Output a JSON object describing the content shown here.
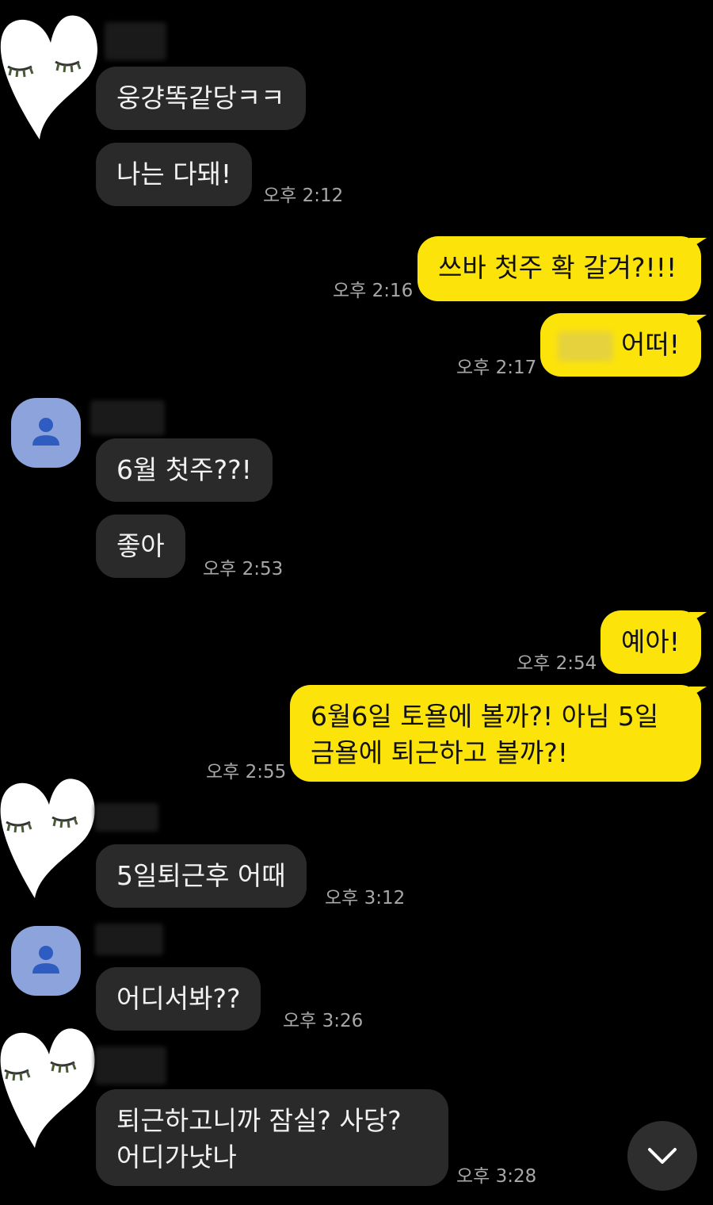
{
  "messages": [
    {
      "text": "웅걍똑같당ㅋㅋ"
    },
    {
      "text": "나는 다돼!",
      "time": "오후 2:12"
    },
    {
      "text": "쓰바 첫주 확 갈겨?!!!",
      "time": "오후 2:16"
    },
    {
      "text": "어떠!",
      "time": "오후 2:17"
    },
    {
      "text": "6월 첫주??!"
    },
    {
      "text": "좋아",
      "time": "오후 2:53"
    },
    {
      "text": "예아!",
      "time": "오후 2:54"
    },
    {
      "line1": "6월6일 토욜에 볼까?! 아님 5일",
      "line2": "금욜에 퇴근하고 볼까?!",
      "time": "오후 2:55"
    },
    {
      "text": "5일퇴근후 어때",
      "time": "오후 3:12"
    },
    {
      "text": "어디서봐??",
      "time": "오후 3:26"
    },
    {
      "line1": "퇴근하고니까 잠실? 사당?",
      "line2": "어디가냣나",
      "time": "오후 3:28"
    }
  ],
  "colors": {
    "my_bubble": "#fce40a",
    "their_bubble": "#2a2a2a",
    "background": "#000000"
  },
  "icons": {
    "scroll_down": "chevron-down-icon",
    "default_avatar": "person-icon",
    "heart_avatar": "heart-sleepy-eyes-icon"
  }
}
